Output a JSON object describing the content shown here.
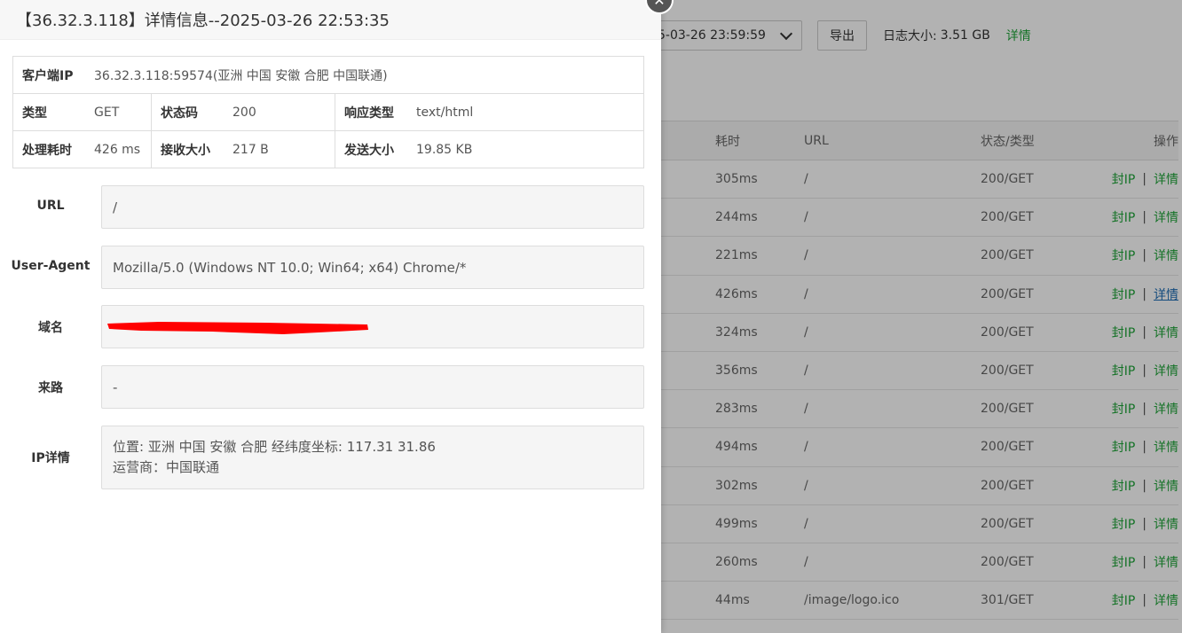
{
  "background": {
    "date_range_text": "5-03-26 23:59:59",
    "export_label": "导出",
    "log_size_label": "日志大小:",
    "log_size_value": "3.51 GB",
    "detail_link": "详情",
    "table": {
      "headers": {
        "time": "耗时",
        "url": "URL",
        "status": "状态/类型",
        "ops": "操作"
      },
      "ban_label": "封IP",
      "sep": "|",
      "detail_label": "详情",
      "rows": [
        {
          "time": "305ms",
          "url": "/",
          "status": "200/GET"
        },
        {
          "time": "244ms",
          "url": "/",
          "status": "200/GET"
        },
        {
          "time": "221ms",
          "url": "/",
          "status": "200/GET"
        },
        {
          "time": "426ms",
          "url": "/",
          "status": "200/GET"
        },
        {
          "time": "324ms",
          "url": "/",
          "status": "200/GET"
        },
        {
          "time": "356ms",
          "url": "/",
          "status": "200/GET"
        },
        {
          "time": "283ms",
          "url": "/",
          "status": "200/GET"
        },
        {
          "time": "494ms",
          "url": "/",
          "status": "200/GET"
        },
        {
          "time": "302ms",
          "url": "/",
          "status": "200/GET"
        },
        {
          "time": "499ms",
          "url": "/",
          "status": "200/GET"
        },
        {
          "time": "260ms",
          "url": "/",
          "status": "200/GET"
        },
        {
          "time": "44ms",
          "url": "/image/logo.ico",
          "status": "301/GET"
        }
      ]
    }
  },
  "drawer": {
    "title": "【36.32.3.118】详情信息--2025-03-26 22:53:35",
    "close_icon": "close-icon",
    "info": {
      "client_ip_label": "客户端IP",
      "client_ip_value": "36.32.3.118:59574(亚洲 中国 安徽 合肥 中国联通)",
      "type_label": "类型",
      "type_value": "GET",
      "status_label": "状态码",
      "status_value": "200",
      "resp_type_label": "响应类型",
      "resp_type_value": "text/html",
      "duration_label": "处理耗时",
      "duration_value": "426 ms",
      "recv_label": "接收大小",
      "recv_value": "217 B",
      "send_label": "发送大小",
      "send_value": "19.85 KB"
    },
    "fields": {
      "url_label": "URL",
      "url_value": "/",
      "ua_label": "User-Agent",
      "ua_value": "Mozilla/5.0 (Windows NT 10.0; Win64; x64) Chrome/*",
      "domain_label": "域名",
      "referer_label": "来路",
      "referer_value": "-",
      "ip_label": "IP详情",
      "ip_line1": "位置: 亚洲 中国 安徽 合肥 经纬度坐标: 117.31 31.86",
      "ip_line2": "运营商：中国联通"
    },
    "redaction_color": "#ff0000"
  }
}
